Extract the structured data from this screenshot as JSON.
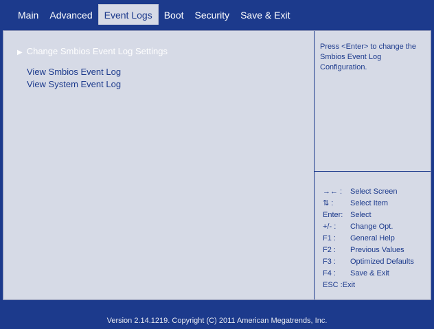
{
  "menu": {
    "tabs": [
      {
        "label": "Main"
      },
      {
        "label": "Advanced"
      },
      {
        "label": "Event Logs"
      },
      {
        "label": "Boot"
      },
      {
        "label": "Security"
      },
      {
        "label": "Save & Exit"
      }
    ],
    "active": "Event Logs"
  },
  "content": {
    "entries": [
      {
        "label": "Change Smbios Event Log Settings",
        "type": "submenu"
      },
      {
        "label": "View Smbios Event Log",
        "type": "link"
      },
      {
        "label": "View System Event Log",
        "type": "link"
      }
    ]
  },
  "help": {
    "text": "Press <Enter> to change the Smbios Event Log Configuration."
  },
  "keys": [
    {
      "key": "→← :",
      "desc": "Select Screen"
    },
    {
      "key": "⇅ :",
      "desc": "Select Item"
    },
    {
      "key": "Enter:",
      "desc": "Select"
    },
    {
      "key": "+/- :",
      "desc": "Change Opt."
    },
    {
      "key": "F1 :",
      "desc": "General Help"
    },
    {
      "key": "F2 :",
      "desc": "Previous Values"
    },
    {
      "key": "F3 :",
      "desc": "Optimized Defaults"
    },
    {
      "key": "F4 :",
      "desc": "Save & Exit"
    },
    {
      "key": "ESC :Exit",
      "desc": ""
    }
  ],
  "footer": {
    "version": "Version 2.14.1219. Copyright (C) 2011 American Megatrends, Inc."
  },
  "colors": {
    "background": "#1c3a8c",
    "panel": "#d6dae6",
    "highlight_text": "#ffffff"
  }
}
